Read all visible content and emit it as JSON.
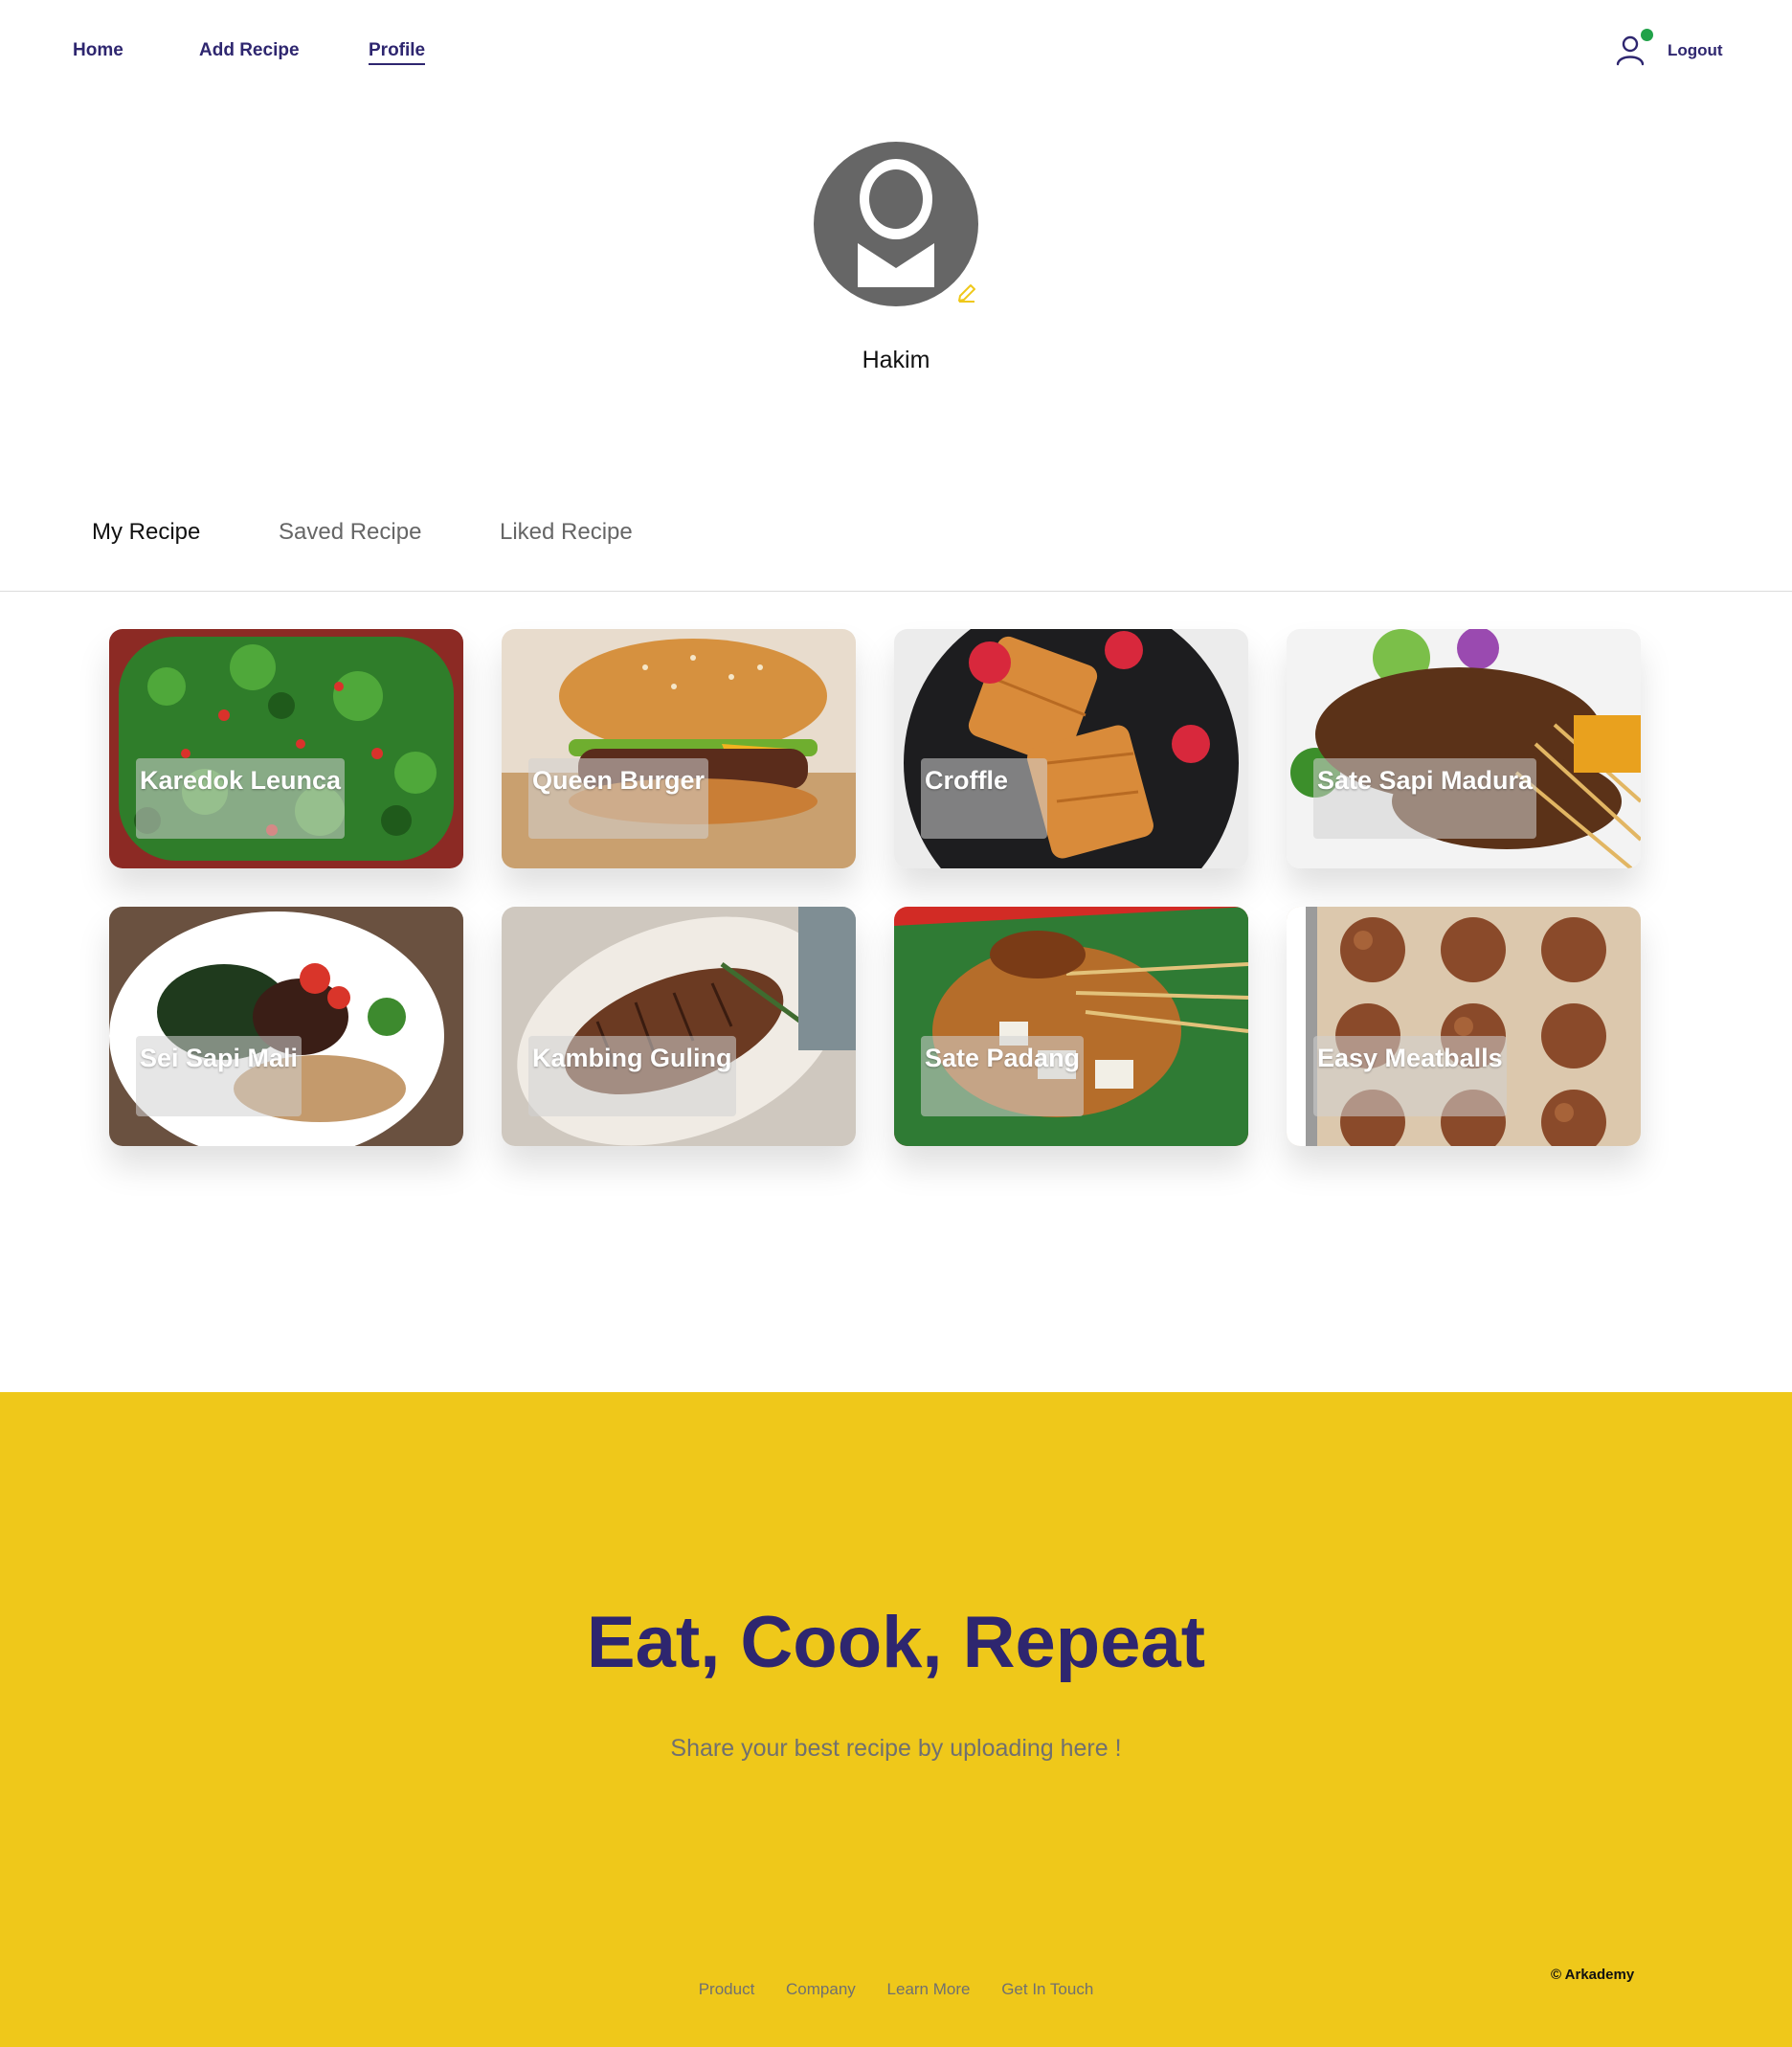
{
  "nav": {
    "links": [
      {
        "label": "Home"
      },
      {
        "label": "Add Recipe"
      },
      {
        "label": "Profile",
        "active": true
      }
    ],
    "logout_label": "Logout",
    "status_dot_color": "#21a249"
  },
  "profile": {
    "name": "Hakim"
  },
  "tabs": [
    {
      "label": "My Recipe",
      "active": true
    },
    {
      "label": "Saved Recipe"
    },
    {
      "label": "Liked Recipe"
    }
  ],
  "recipes": [
    {
      "title": "Karedok Leunca",
      "icon": "karedok-photo"
    },
    {
      "title": "Queen Burger",
      "icon": "burger-photo"
    },
    {
      "title": "Croffle",
      "icon": "croffle-photo"
    },
    {
      "title": "Sate Sapi Madura",
      "icon": "sate-madura-photo"
    },
    {
      "title": "Sei Sapi Mali",
      "icon": "sei-sapi-photo"
    },
    {
      "title": "Kambing Guling",
      "icon": "kambing-photo"
    },
    {
      "title": "Sate Padang",
      "icon": "sate-padang-photo"
    },
    {
      "title": "Easy Meatballs",
      "icon": "meatballs-photo"
    }
  ],
  "footer": {
    "title": "Eat, Cook, Repeat",
    "subtitle": "Share your best recipe by uploading here !",
    "links": [
      "Product",
      "Company",
      "Learn More",
      "Get In Touch"
    ],
    "copyright": "© Arkademy",
    "background_color": "#efc81a",
    "title_color": "#2e266f"
  }
}
